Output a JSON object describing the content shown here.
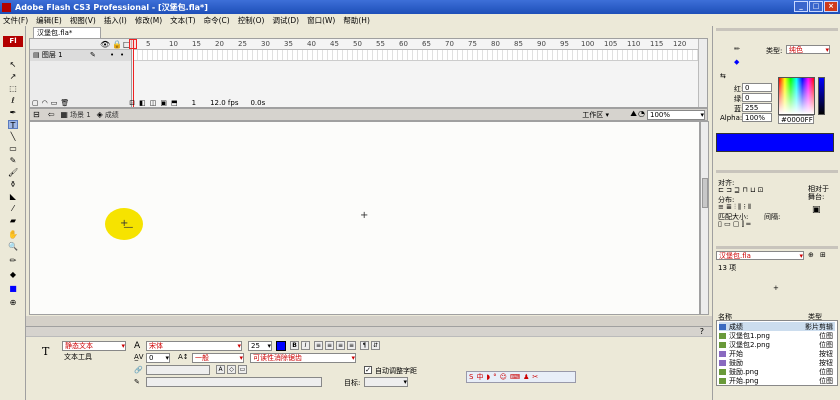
{
  "window": {
    "title": "Adobe Flash CS3 Professional - [汉堡包.fla*]",
    "app_badge": "Fl"
  },
  "menu": [
    "文件(F)",
    "编辑(E)",
    "视图(V)",
    "插入(I)",
    "修改(M)",
    "文本(T)",
    "命令(C)",
    "控制(O)",
    "调试(D)",
    "窗口(W)",
    "帮助(H)"
  ],
  "document": {
    "tab": "汉堡包.fla*"
  },
  "timeline": {
    "layer_name": "图层 1",
    "frame_numbers": [
      "5",
      "10",
      "15",
      "20",
      "25",
      "30",
      "35",
      "40",
      "45",
      "50",
      "55",
      "60",
      "65",
      "70",
      "75",
      "80",
      "85",
      "90",
      "95",
      "100",
      "105",
      "110",
      "115",
      "120"
    ],
    "current_frame": "1",
    "fps": "12.0 fps",
    "time": "0.0s"
  },
  "edit_bar": {
    "scene": "场景 1",
    "breadcrumb": "成绩",
    "workspace": "工作区",
    "zoom": "100%"
  },
  "properties": {
    "text_type": "静态文本",
    "tool_name": "文本工具",
    "font": "宋体",
    "size": "25",
    "letter_spacing": "0",
    "char_position": "一般",
    "rendering": "可读性消除锯齿",
    "auto_kern_label": "自动调整字距",
    "target_label": "目标:"
  },
  "color_panel": {
    "type_label": "类型:",
    "type_value": "纯色",
    "red_label": "红:",
    "red": "0",
    "green_label": "绿:",
    "green": "0",
    "blue_label": "蓝:",
    "blue": "255",
    "alpha_label": "Alpha:",
    "alpha": "100%",
    "hex": "#0000FF",
    "fill_color": "#0000ff"
  },
  "align_panel": {
    "align_label": "对齐:",
    "distribute_label": "分布:",
    "match_size_label": "匹配大小:",
    "spacing_label": "间隔:",
    "to_stage_label": "相对于舞台:"
  },
  "library": {
    "file": "汉堡包.fla",
    "count": "13 项",
    "col_name": "名称",
    "col_type": "类型",
    "items": [
      {
        "name": "成绩",
        "type": "影片剪辑"
      },
      {
        "name": "汉堡包1.png",
        "type": "位图"
      },
      {
        "name": "汉堡包2.png",
        "type": "位图"
      },
      {
        "name": "开始",
        "type": "按钮"
      },
      {
        "name": "鼓励",
        "type": "按钮"
      },
      {
        "name": "鼓励.png",
        "type": "位图"
      },
      {
        "name": "开始.png",
        "type": "位图"
      }
    ]
  }
}
